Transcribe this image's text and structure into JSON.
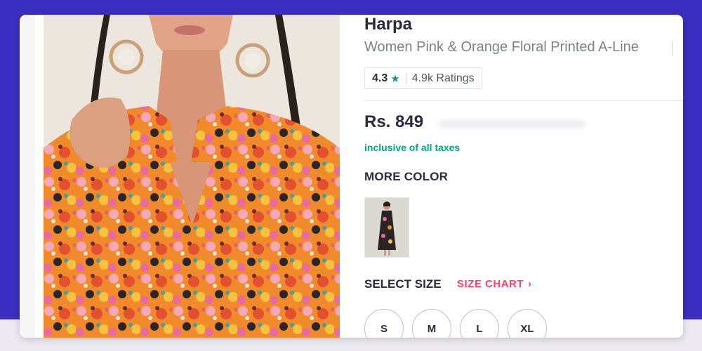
{
  "colors": {
    "page_background": "#3a2fc0",
    "accent_pink": "#ff3f6c",
    "tax_green": "#03a685",
    "star_teal": "#14958f",
    "text_dark": "#282c3f",
    "text_muted": "#7e818c"
  },
  "product": {
    "brand": "Harpa",
    "name": "Women Pink & Orange Floral Printed A-Line",
    "image_icon": "product-photo",
    "rating": {
      "value": "4.3",
      "star_icon": "★",
      "count_label": "4.9k Ratings"
    },
    "price": "Rs. 849",
    "tax_note": "inclusive of all taxes"
  },
  "more_color": {
    "heading": "MORE COLOR",
    "options": [
      {
        "icon": "dress-thumbnail"
      }
    ]
  },
  "sizes": {
    "heading": "SELECT SIZE",
    "chart_link": "SIZE CHART",
    "chart_chevron": "›",
    "options": [
      "S",
      "M",
      "L",
      "XL"
    ]
  }
}
